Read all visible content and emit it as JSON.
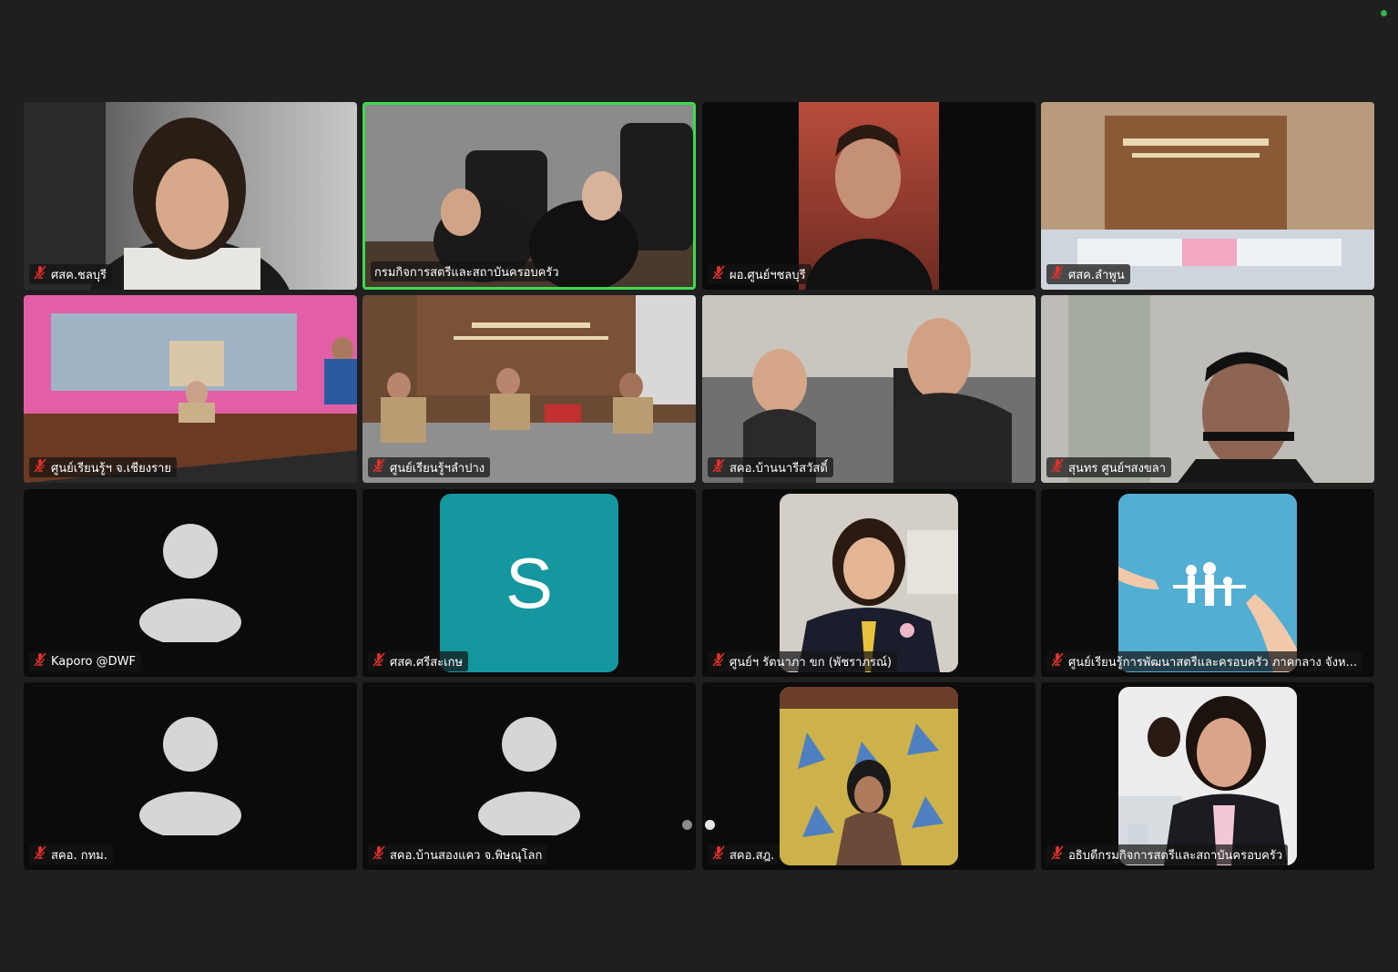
{
  "colors": {
    "background": "#1f1f1f",
    "tile": "#0b0b0b",
    "active_speaker_border": "#3ddc4f",
    "muted_icon": "#e0302a",
    "avatar_tile": "#14979f",
    "status_dot": "#2fb54a"
  },
  "icons": {
    "muted": "mic-muted-icon",
    "avatar": "person-placeholder-icon"
  },
  "participants": [
    {
      "name": "ศสค.ชลบุรี",
      "muted": true,
      "video": "camera"
    },
    {
      "name": "กรมกิจการสตรีและสถาบันครอบครัว",
      "muted": false,
      "video": "camera",
      "active_speaker": true
    },
    {
      "name": "ผอ.ศูนย์ฯชลบุรี",
      "muted": true,
      "video": "camera"
    },
    {
      "name": "ศสค.ลำพูน",
      "muted": true,
      "video": "camera"
    },
    {
      "name": "ศูนย์เรียนรู้ฯ จ.เชียงราย",
      "muted": true,
      "video": "camera"
    },
    {
      "name": "ศูนย์เรียนรู้ฯลำปาง",
      "muted": true,
      "video": "camera"
    },
    {
      "name": "สคอ.บ้านนารีสวัสดิ์",
      "muted": true,
      "video": "camera"
    },
    {
      "name": "สุนทร ศูนย์ฯสงขลา",
      "muted": true,
      "video": "camera"
    },
    {
      "name": "Kaporo @DWF",
      "muted": true,
      "video": "avatar"
    },
    {
      "name": "ศสค.ศรีสะเกษ",
      "muted": true,
      "video": "letter",
      "letter": "S"
    },
    {
      "name": "ศูนย์ฯ รัตนาภา ขก (พัชราภรณ์)",
      "muted": true,
      "video": "photo"
    },
    {
      "name": "ศูนย์เรียนรู้การพัฒนาสตรีและครอบครัว ภาคกลาง จังห...",
      "muted": true,
      "video": "photo"
    },
    {
      "name": "สคอ. กทม.",
      "muted": true,
      "video": "avatar"
    },
    {
      "name": "สคอ.บ้านสองแคว จ.พิษณุโลก",
      "muted": true,
      "video": "avatar"
    },
    {
      "name": "สคอ.สฎ.",
      "muted": true,
      "video": "photo"
    },
    {
      "name": "อธิบดีกรมกิจการสตรีและสถาบันครอบครัว",
      "muted": true,
      "video": "photo"
    }
  ],
  "pagination": {
    "current_page": 1,
    "total_pages": 2
  }
}
